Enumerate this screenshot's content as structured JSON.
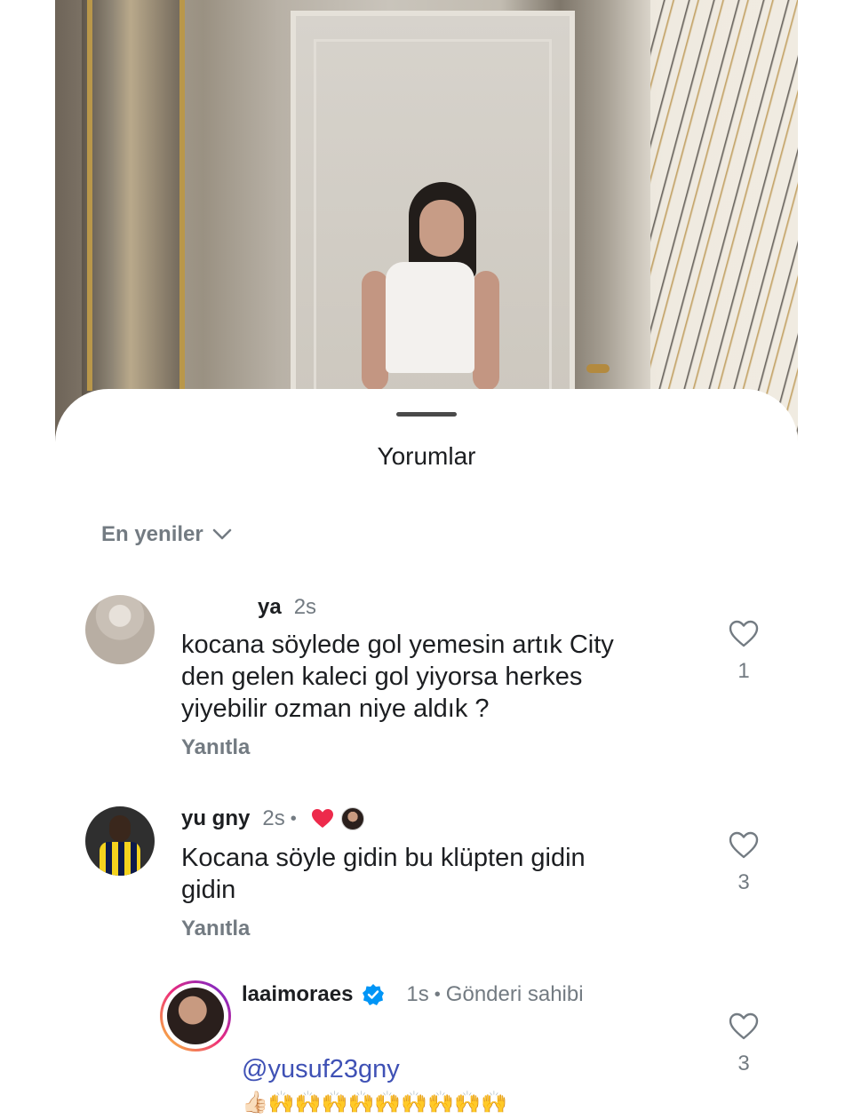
{
  "sheet": {
    "title": "Yorumlar",
    "sort_label": "En yeniler"
  },
  "comments": [
    {
      "username": "ya",
      "time": "2s",
      "text": "kocana söylede gol yemesin artık City\nden gelen kaleci gol yiyorsa herkes\nyiyebilir ozman niye aldık ?",
      "reply_label": "Yanıtla",
      "like_count": "1"
    },
    {
      "username": "yu   gny",
      "time": "2s",
      "separator": "•",
      "text": "Kocana söyle gidin bu klüpten gidin\ngidin",
      "reply_label": "Yanıtla",
      "like_count": "3"
    }
  ],
  "reply": {
    "username": "laaimoraes",
    "time": "1s",
    "separator": "•",
    "owner_label": "Gönderi sahibi",
    "mention": "@yusuf23gny",
    "emojis": "👍🏻🙌🙌🙌🙌🙌🙌🙌🙌🙌",
    "like_count": "3"
  },
  "colors": {
    "heart_liked": "#ed2a4b",
    "verified": "#0095f6",
    "mention": "#3f51b5",
    "secondary_text": "#737b82"
  }
}
